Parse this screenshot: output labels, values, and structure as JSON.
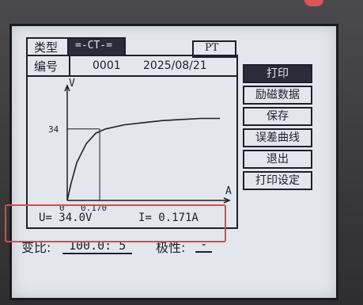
{
  "header": {
    "type_label": "类型",
    "mode_value": "=-CT-=",
    "pt_label": "PT"
  },
  "id_row": {
    "id_label": "编号",
    "id_value": "0001",
    "date": "2025/08/21"
  },
  "chart_data": {
    "type": "line",
    "title": "",
    "xlabel": "A",
    "ylabel": "V",
    "ytick_label": "34",
    "xtick_label": "0.170",
    "origin_label": "0",
    "knee_point": {
      "x": 0.17,
      "y": 34
    },
    "xlim": [
      0,
      0.82
    ],
    "ylim": [
      0,
      52
    ],
    "series": [
      {
        "values_x": [
          0,
          0.02,
          0.05,
          0.1,
          0.15,
          0.2,
          0.3,
          0.4,
          0.5,
          0.6,
          0.7,
          0.8
        ],
        "values_y": [
          0,
          8,
          18,
          27,
          32,
          34,
          36,
          37,
          38,
          38.5,
          39,
          39
        ]
      }
    ]
  },
  "status": {
    "voltage": "U= 34.0V",
    "current": "I= 0.171A"
  },
  "ratio_row": {
    "ratio_label": "变比:",
    "ratio_value": "100.0: 5",
    "polarity_label": "极性:",
    "polarity_value": "-"
  },
  "menu": {
    "print": "打印",
    "excitation_data": "励磁数据",
    "save": "保存",
    "error_curve": "误差曲线",
    "exit": "退出",
    "print_settings": "打印设定"
  },
  "colors": {
    "screen": "#e3e6ec",
    "ink": "#1d1f2c",
    "highlight": "#e8453c"
  }
}
